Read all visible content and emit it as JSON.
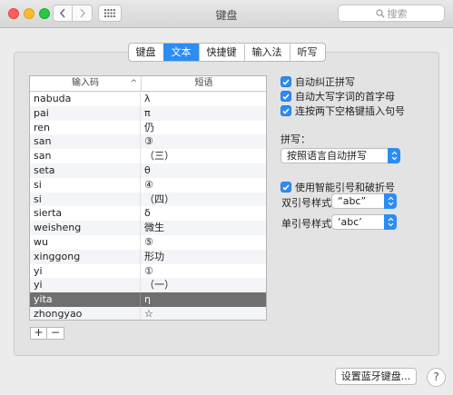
{
  "window": {
    "title": "键盘",
    "search_placeholder": "搜索"
  },
  "tabs": [
    {
      "label": "键盘",
      "active": false
    },
    {
      "label": "文本",
      "active": true
    },
    {
      "label": "快捷键",
      "active": false
    },
    {
      "label": "输入法",
      "active": false
    },
    {
      "label": "听写",
      "active": false
    }
  ],
  "table": {
    "col1": "输入码",
    "col2": "短语",
    "rows": [
      {
        "code": "nabuda",
        "phrase": "λ"
      },
      {
        "code": "pai",
        "phrase": "π"
      },
      {
        "code": "ren",
        "phrase": "仍"
      },
      {
        "code": "san",
        "phrase": "③"
      },
      {
        "code": "san",
        "phrase": "（三）"
      },
      {
        "code": "seta",
        "phrase": "θ"
      },
      {
        "code": "si",
        "phrase": "④"
      },
      {
        "code": "si",
        "phrase": "（四）"
      },
      {
        "code": "sierta",
        "phrase": "δ"
      },
      {
        "code": "weisheng",
        "phrase": "微生"
      },
      {
        "code": "wu",
        "phrase": "⑤"
      },
      {
        "code": "xinggong",
        "phrase": "形功"
      },
      {
        "code": "yi",
        "phrase": "①"
      },
      {
        "code": "yi",
        "phrase": "（一）"
      },
      {
        "code": "yita",
        "phrase": "η",
        "selected": true
      },
      {
        "code": "zhongyao",
        "phrase": "☆"
      }
    ]
  },
  "add_label": "+",
  "remove_label": "−",
  "options": {
    "autocorrect": "自动纠正拼写",
    "autocap": "自动大写字词的首字母",
    "double_space": "连按两下空格键插入句号",
    "spelling_label": "拼写：",
    "spelling_value": "按照语言自动拼写",
    "smart_quotes": "使用智能引号和破折号",
    "double_quote_label": "双引号样式",
    "double_quote_value": "“abc”",
    "single_quote_label": "单引号样式",
    "single_quote_value": "‘abc’"
  },
  "bluetooth_button": "设置蓝牙键盘...",
  "help_label": "?",
  "accent_color": "#2c8cf3"
}
